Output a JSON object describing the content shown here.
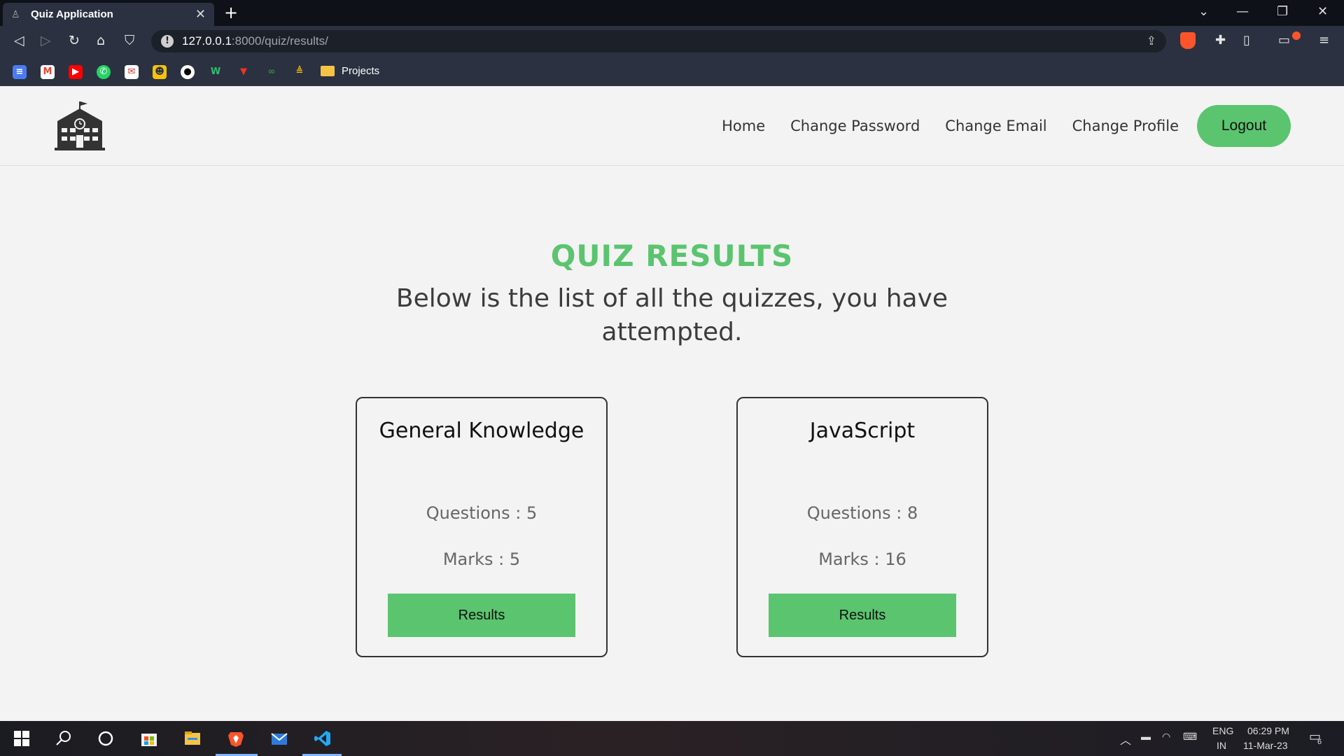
{
  "browser": {
    "tab_title": "Quiz Application",
    "url_host": "127.0.0.1",
    "url_path": ":8000/quiz/results/",
    "bookmark_folder": "Projects"
  },
  "nav": {
    "links": [
      "Home",
      "Change Password",
      "Change Email",
      "Change Profile"
    ],
    "logout_label": "Logout"
  },
  "main": {
    "title": "QUIZ RESULTS",
    "subtitle": "Below is the list of all the quizzes, you have attempted."
  },
  "quizzes": [
    {
      "name": "General Knowledge",
      "questions": "Questions : 5",
      "marks": "Marks : 5",
      "button": "Results"
    },
    {
      "name": "JavaScript",
      "questions": "Questions : 8",
      "marks": "Marks : 16",
      "button": "Results"
    }
  ],
  "taskbar": {
    "language": "ENG",
    "region": "IN",
    "time": "06:29 PM",
    "date": "11-Mar-23",
    "notifications": "6"
  },
  "colors": {
    "accent": "#5bc46f",
    "chrome": "#2b3140"
  }
}
